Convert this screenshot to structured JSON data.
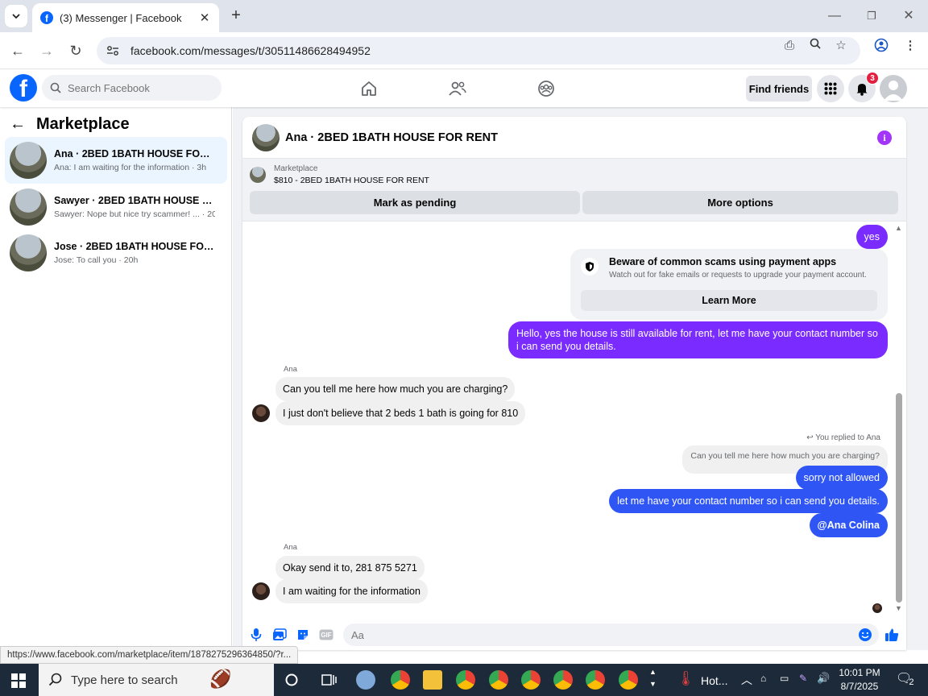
{
  "browser": {
    "tab_title": "(3) Messenger | Facebook",
    "url": "facebook.com/messages/t/30511486628494952",
    "status_url": "https://www.facebook.com/marketplace/item/1878275296364850/?r..."
  },
  "header": {
    "search_placeholder": "Search Facebook",
    "find_friends": "Find friends",
    "notification_count": "3"
  },
  "sidebar": {
    "title": "Marketplace",
    "conversations": [
      {
        "name": "Ana · 2BED 1BATH HOUSE FOR RE...",
        "preview": "Ana: I am waiting for the information · 3h"
      },
      {
        "name": "Sawyer · 2BED 1BATH HOUSE FOR ...",
        "preview": "Sawyer: Nope but nice try scammer! ... · 20h"
      },
      {
        "name": "Jose · 2BED 1BATH HOUSE FOR RE...",
        "preview": "Jose: To call you · 20h"
      }
    ]
  },
  "chat": {
    "title": "Ana · 2BED 1BATH HOUSE FOR RENT",
    "listing_label": "Marketplace",
    "listing_item": "$810 - 2BED 1BATH HOUSE FOR RENT",
    "mark_pending": "Mark as pending",
    "more_options": "More options",
    "scam_title": "Beware of common scams using payment apps",
    "scam_sub": "Watch out for fake emails or requests to upgrade your payment account.",
    "learn_more": "Learn More",
    "messages": {
      "out_yes": "yes",
      "out_available": "Hello, yes the house is still available for rent, let me have your contact number so i can send you details.",
      "sender1": "Ana",
      "in_charging": "Can you tell me here how much you are charging?",
      "in_believe": "I just don't believe that 2 beds 1 bath is going for 810",
      "replied_to": "You replied to Ana",
      "quoted": "Can you tell me here how much you are charging?",
      "out_not_allowed": "sorry not allowed",
      "out_contact": "let me have your contact number so i can send you details.",
      "out_mention": "@Ana Colina",
      "sender2": "Ana",
      "in_send": "Okay send it to, 281 875 5271",
      "in_waiting": "I am waiting for the information"
    },
    "composer_placeholder": "Aa"
  },
  "taskbar": {
    "search_text": "Type here to search",
    "weather": "Hot...",
    "time": "10:01 PM",
    "date": "8/7/2025",
    "notification_count": "2"
  },
  "colors": {
    "fb_blue": "#0866ff",
    "bubble_purple": "#7a2bff",
    "bubble_blue": "#2f56f5",
    "accent_icon": "#a334fa"
  }
}
